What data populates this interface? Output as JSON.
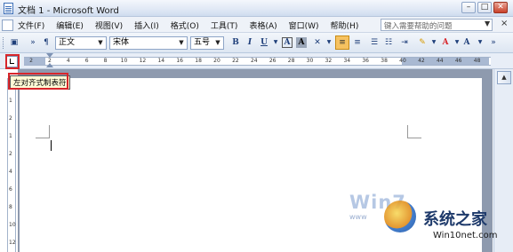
{
  "window": {
    "title": "文档 1 - Microsoft Word",
    "minimize": "–",
    "maximize": "□",
    "close": "✕"
  },
  "menu": {
    "items": [
      "文件(F)",
      "编辑(E)",
      "视图(V)",
      "插入(I)",
      "格式(O)",
      "工具(T)",
      "表格(A)",
      "窗口(W)",
      "帮助(H)"
    ],
    "help_placeholder": "键入需要帮助的问题",
    "close": "×"
  },
  "toolbar": {
    "style": "正文",
    "font": "宋体",
    "size": "五号",
    "bold": "B",
    "italic": "I",
    "underline": "U",
    "char_border": "A",
    "char_shading": "A",
    "font_color": "A"
  },
  "ruler": {
    "numbers": [
      "2",
      "2",
      "4",
      "6",
      "8",
      "10",
      "12",
      "14",
      "16",
      "18",
      "20",
      "22",
      "24",
      "26",
      "28",
      "30",
      "32",
      "34",
      "36",
      "38",
      "40",
      "42",
      "44",
      "46",
      "48"
    ]
  },
  "vruler": {
    "numbers": [
      "1",
      "2",
      "1",
      "2",
      "4",
      "6",
      "8",
      "10",
      "12"
    ]
  },
  "tooltip": {
    "text": "左对齐式制表符"
  },
  "watermark": {
    "brand": "Win7",
    "site_cn": "系统之家",
    "url": "Win10net.com",
    "www": "www"
  }
}
